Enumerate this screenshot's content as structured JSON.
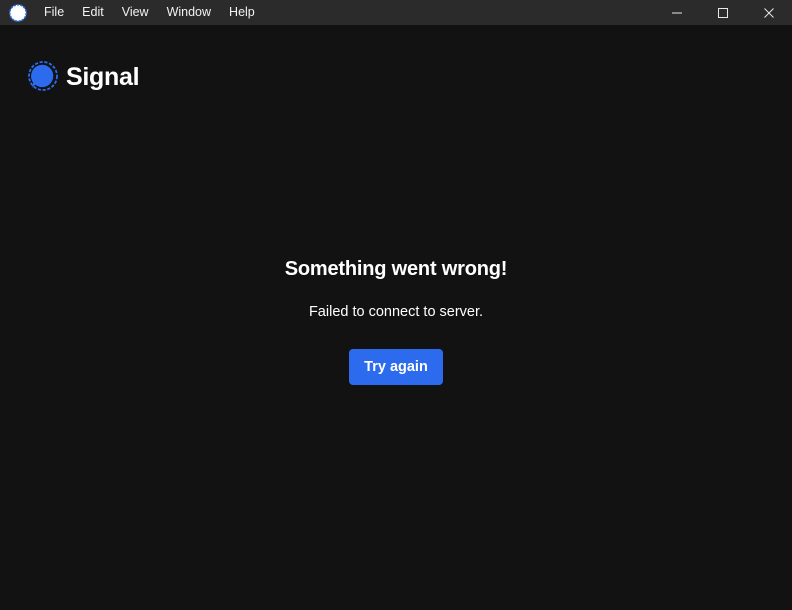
{
  "window": {
    "app_icon": "signal-bubble-icon",
    "controls": {
      "minimize_icon": "minimize-icon",
      "maximize_icon": "maximize-icon",
      "close_icon": "close-icon"
    }
  },
  "menu": {
    "items": [
      {
        "label": "File"
      },
      {
        "label": "Edit"
      },
      {
        "label": "View"
      },
      {
        "label": "Window"
      },
      {
        "label": "Help"
      }
    ]
  },
  "brand": {
    "logo_icon": "signal-logo-icon",
    "name": "Signal"
  },
  "error": {
    "title": "Something went wrong!",
    "message": "Failed to connect to server.",
    "retry_label": "Try again"
  },
  "colors": {
    "background": "#121212",
    "titlebar": "#2b2b2b",
    "accent": "#2c6bed",
    "text": "#ffffff"
  }
}
